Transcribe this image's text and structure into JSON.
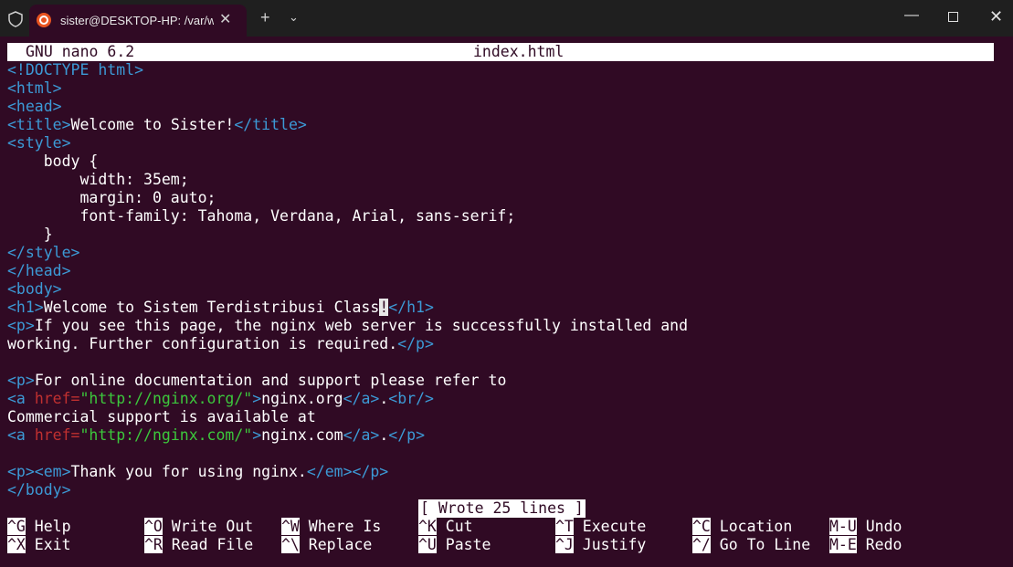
{
  "window": {
    "tab_title": "sister@DESKTOP-HP: /var/ww",
    "icons": [
      "shield-icon",
      "ubuntu-icon",
      "close-icon",
      "plus-icon",
      "chevron-down-icon",
      "minimize-icon",
      "maximize-icon",
      "window-close-icon"
    ]
  },
  "nano": {
    "version": "GNU nano 6.2",
    "filename": "index.html",
    "status_message": "[ Wrote 25 lines ]"
  },
  "file_lines": [
    [
      [
        "t",
        "<!DOCTYPE html>"
      ]
    ],
    [
      [
        "t",
        "<html>"
      ]
    ],
    [
      [
        "t",
        "<head>"
      ]
    ],
    [
      [
        "t",
        "<title>"
      ],
      [
        "x",
        "Welcome to Sister!"
      ],
      [
        "t",
        "</title>"
      ]
    ],
    [
      [
        "t",
        "<style>"
      ]
    ],
    [
      [
        "x",
        "    body {"
      ]
    ],
    [
      [
        "x",
        "        width: 35em;"
      ]
    ],
    [
      [
        "x",
        "        margin: 0 auto;"
      ]
    ],
    [
      [
        "x",
        "        font-family: Tahoma, Verdana, Arial, sans-serif;"
      ]
    ],
    [
      [
        "x",
        "    }"
      ]
    ],
    [
      [
        "t",
        "</style>"
      ]
    ],
    [
      [
        "t",
        "</head>"
      ]
    ],
    [
      [
        "t",
        "<body>"
      ]
    ],
    [
      [
        "t",
        "<h1>"
      ],
      [
        "x",
        "Welcome to Sistem Terdistribusi Class"
      ],
      [
        "c",
        "!"
      ],
      [
        "t",
        "</h1>"
      ]
    ],
    [
      [
        "t",
        "<p>"
      ],
      [
        "x",
        "If you see this page, the nginx web server is successfully installed and"
      ]
    ],
    [
      [
        "x",
        "working. Further configuration is required."
      ],
      [
        "t",
        "</p>"
      ]
    ],
    [],
    [
      [
        "t",
        "<p>"
      ],
      [
        "x",
        "For online documentation and support please refer to"
      ]
    ],
    [
      [
        "t",
        "<a "
      ],
      [
        "a",
        "href="
      ],
      [
        "s",
        "\"http://nginx.org/\""
      ],
      [
        "t",
        ">"
      ],
      [
        "x",
        "nginx.org"
      ],
      [
        "t",
        "</a>"
      ],
      [
        "x",
        "."
      ],
      [
        "t",
        "<br/>"
      ]
    ],
    [
      [
        "x",
        "Commercial support is available at"
      ]
    ],
    [
      [
        "t",
        "<a "
      ],
      [
        "a",
        "href="
      ],
      [
        "s",
        "\"http://nginx.com/\""
      ],
      [
        "t",
        ">"
      ],
      [
        "x",
        "nginx.com"
      ],
      [
        "t",
        "</a>"
      ],
      [
        "x",
        "."
      ],
      [
        "t",
        "</p>"
      ]
    ],
    [],
    [
      [
        "t",
        "<p><em>"
      ],
      [
        "x",
        "Thank you for using nginx."
      ],
      [
        "t",
        "</em></p>"
      ]
    ],
    [
      [
        "t",
        "</body>"
      ]
    ]
  ],
  "shortcuts": [
    {
      "key": "^G",
      "label": "Help"
    },
    {
      "key": "^X",
      "label": "Exit"
    },
    {
      "key": "^O",
      "label": "Write Out"
    },
    {
      "key": "^R",
      "label": "Read File"
    },
    {
      "key": "^W",
      "label": "Where Is"
    },
    {
      "key": "^\\",
      "label": "Replace"
    },
    {
      "key": "^K",
      "label": "Cut"
    },
    {
      "key": "^U",
      "label": "Paste"
    },
    {
      "key": "^T",
      "label": "Execute"
    },
    {
      "key": "^J",
      "label": "Justify"
    },
    {
      "key": "^C",
      "label": "Location"
    },
    {
      "key": "^/",
      "label": "Go To Line"
    },
    {
      "key": "M-U",
      "label": "Undo"
    },
    {
      "key": "M-E",
      "label": "Redo"
    }
  ]
}
